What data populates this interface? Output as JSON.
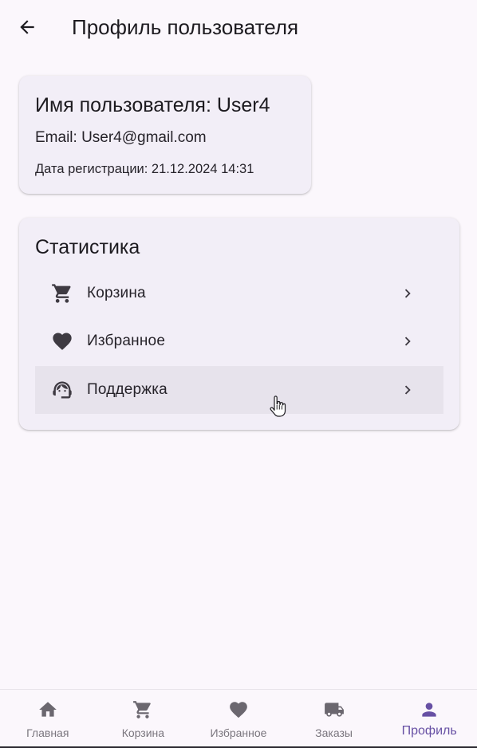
{
  "appbar": {
    "title": "Профиль пользователя",
    "back_icon": "arrow-back-icon"
  },
  "user_card": {
    "username": "Имя пользователя: User4",
    "email": "Email: User4@gmail.com",
    "registration": "Дата регистрации: 21.12.2024 14:31"
  },
  "stats": {
    "title": "Статистика",
    "items": [
      {
        "label": "Корзина",
        "icon": "cart-icon",
        "chevron": "chevron-right-icon"
      },
      {
        "label": "Избранное",
        "icon": "heart-icon",
        "chevron": "chevron-right-icon"
      },
      {
        "label": "Поддержка",
        "icon": "support-agent-icon",
        "chevron": "chevron-right-icon",
        "hovered": true
      }
    ]
  },
  "bottom_nav": {
    "items": [
      {
        "label": "Главная",
        "icon": "home-icon"
      },
      {
        "label": "Корзина",
        "icon": "cart-icon"
      },
      {
        "label": "Избранное",
        "icon": "heart-icon"
      },
      {
        "label": "Заказы",
        "icon": "truck-icon"
      },
      {
        "label": "Профиль",
        "icon": "person-icon",
        "active": true
      }
    ]
  },
  "colors": {
    "background": "#fbf7fc",
    "card": "#f2eef7",
    "hover_row": "#e7e3ec",
    "accent": "#6750a4",
    "icon_dark": "#3e3a42",
    "nav_inactive": "#7a767e"
  }
}
